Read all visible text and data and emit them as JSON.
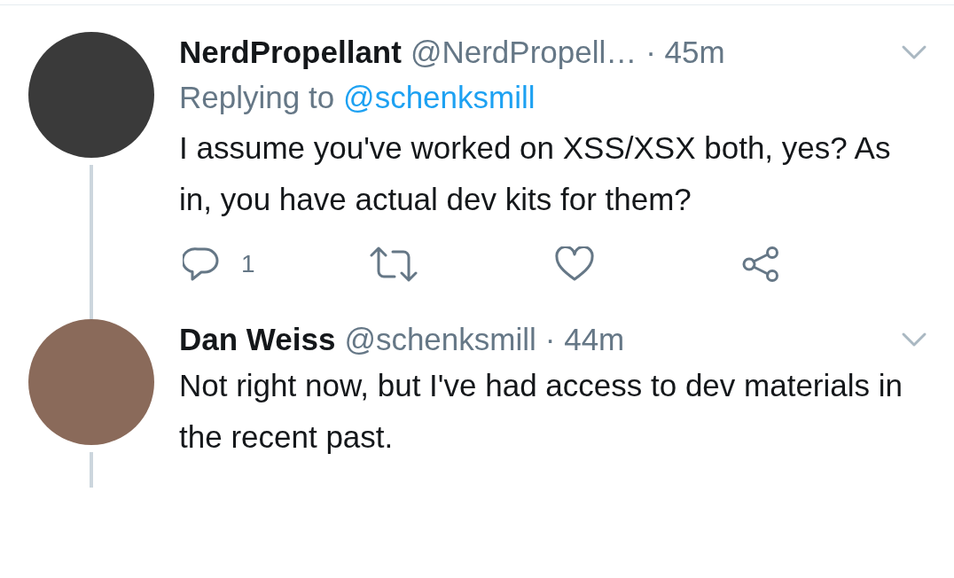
{
  "tweets": [
    {
      "name": "NerdPropellant",
      "handle": "@NerdPropell…",
      "time": "· 45m",
      "reply_prefix": "Replying to",
      "reply_to": "@schenksmill",
      "text": "I assume you've worked on XSS/XSX both, yes? As in, you have actual dev kits for them?",
      "actions": [
        {
          "kind": "reply",
          "count": "1"
        },
        {
          "kind": "retweet"
        },
        {
          "kind": "like"
        },
        {
          "kind": "share"
        }
      ]
    },
    {
      "name": "Dan Weiss",
      "handle": "@schenksmill",
      "time": "· 44m",
      "text": "Not right now, but I've had access to dev materials in the recent past."
    }
  ]
}
